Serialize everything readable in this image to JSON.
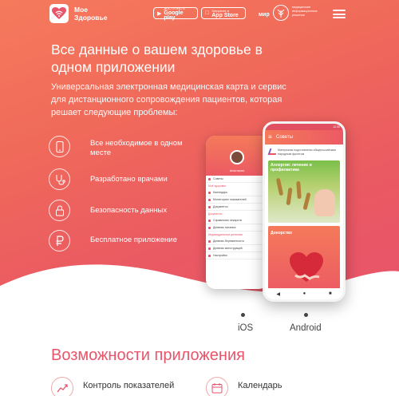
{
  "header": {
    "logo_text": "Мое\nЗдоровье",
    "google_play": {
      "small": "ДОСТУПНО В",
      "big": "Google play"
    },
    "app_store": {
      "small": "Загрузите в",
      "big": "App Store"
    },
    "partner": {
      "name": "мир",
      "caption": "медицинские информационные решения"
    }
  },
  "hero": {
    "title": "Все данные о вашем здоровье в одном приложении",
    "subtitle": "Универсальная электронная медицинская карта и сервис для дистанционного сопровождения пациентов, которая решает следующие проблемы:",
    "features": [
      {
        "icon": "phone-icon",
        "label": "Все необходимое в одном месте"
      },
      {
        "icon": "stethoscope-icon",
        "label": "Разработано врачами"
      },
      {
        "icon": "lock-icon",
        "label": "Безопасность данных"
      },
      {
        "icon": "ruble-icon",
        "label": "Бесплатное приложение"
      }
    ]
  },
  "phone_back": {
    "user_name": "Анастасия",
    "items": [
      {
        "section": "",
        "label": "Советы"
      },
      {
        "section": "Моё здоровье",
        "label": "Календарь"
      },
      {
        "section": "",
        "label": "Мониторинг показателей"
      },
      {
        "section": "",
        "label": "Документы"
      },
      {
        "section": "Документы",
        "label": "Справочник лекарств"
      },
      {
        "section": "",
        "label": "Дневник питания"
      },
      {
        "section": "Индивидуальные дневники",
        "label": "Дневник беременности"
      },
      {
        "section": "",
        "label": "Дневник менструаций"
      },
      {
        "section": "",
        "label": "Настройки"
      }
    ]
  },
  "phone_front": {
    "status_time": "12:30",
    "title": "Советы",
    "note": "Материалы подготовлены общероссийским народным фронтом",
    "cards": [
      {
        "label": "Аллергия: лечение и профилактика"
      },
      {
        "label": "Донорство"
      }
    ]
  },
  "platforms": {
    "ios": "iOS",
    "android": "Android"
  },
  "capabilities": {
    "title": "Возможности приложения",
    "items": [
      {
        "icon": "chart-icon",
        "label": "Контроль показателей"
      },
      {
        "icon": "calendar-icon",
        "label": "Календарь"
      }
    ]
  }
}
